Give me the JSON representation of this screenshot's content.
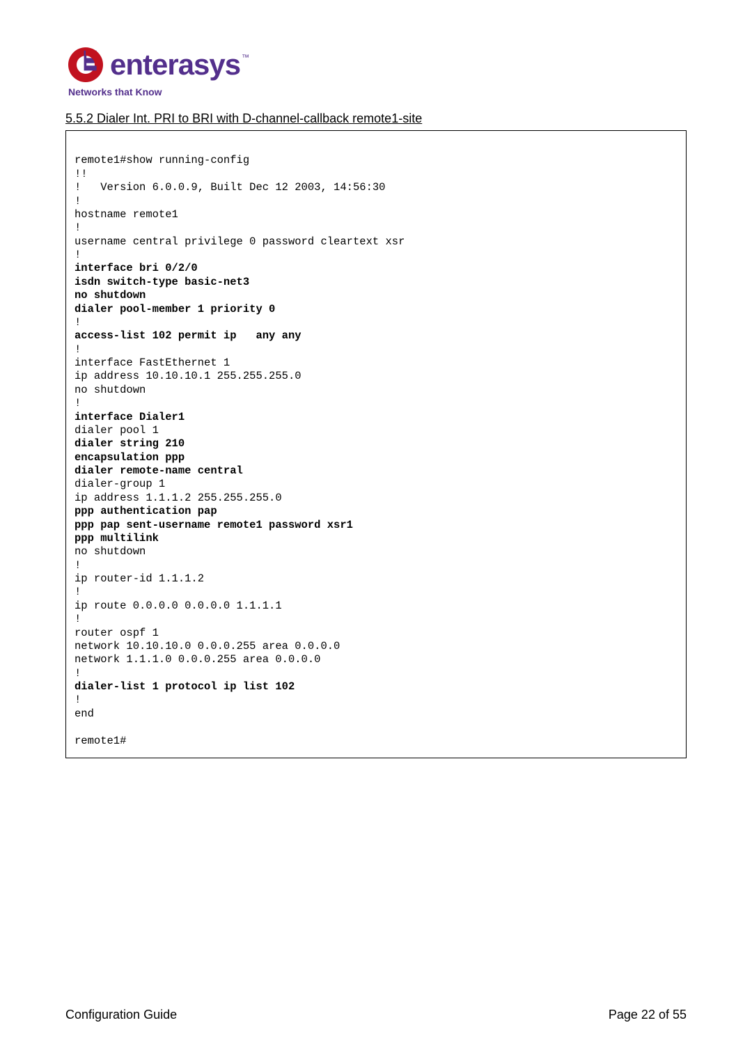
{
  "logo": {
    "brand": "enterasys",
    "tm": "™",
    "tagline": "Networks that Know",
    "mark_colors": {
      "red": "#c1121f",
      "purple": "#532f8c"
    }
  },
  "section_title": "5.5.2 Dialer Int. PRI to BRI with D-channel-callback remote1-site",
  "code": {
    "l01": "remote1#show running-config",
    "l02": "!!",
    "l03": "!   Version 6.0.0.9, Built Dec 12 2003, 14:56:30",
    "l04": "!",
    "l05": "hostname remote1",
    "l06": "!",
    "l07": "username central privilege 0 password cleartext xsr",
    "l08": "!",
    "l09": "interface bri 0/2/0",
    "l10": "isdn switch-type basic-net3",
    "l11": "no shutdown",
    "l12": "dialer pool-member 1 priority 0",
    "l13": "!",
    "l14": "access-list 102 permit ip   any any",
    "l15": "!",
    "l16": "interface FastEthernet 1",
    "l17": "ip address 10.10.10.1 255.255.255.0",
    "l18": "no shutdown",
    "l19": "!",
    "l20": "interface Dialer1",
    "l21": "dialer pool 1",
    "l22": "dialer string 210",
    "l23": "encapsulation ppp",
    "l24": "dialer remote-name central",
    "l25": "dialer-group 1",
    "l26": "ip address 1.1.1.2 255.255.255.0",
    "l27": "ppp authentication pap",
    "l28": "ppp pap sent-username remote1 password xsr1",
    "l29": "ppp multilink",
    "l30": "no shutdown",
    "l31": "!",
    "l32": "ip router-id 1.1.1.2",
    "l33": "!",
    "l34": "ip route 0.0.0.0 0.0.0.0 1.1.1.1",
    "l35": "!",
    "l36": "router ospf 1",
    "l37": "network 10.10.10.0 0.0.0.255 area 0.0.0.0",
    "l38": "network 1.1.1.0 0.0.0.255 area 0.0.0.0",
    "l39": "!",
    "l40": "dialer-list 1 protocol ip list 102",
    "l41": "!",
    "l42": "end",
    "l43": "remote1#"
  },
  "footer": {
    "left": "Configuration Guide",
    "right": "Page 22 of 55"
  }
}
